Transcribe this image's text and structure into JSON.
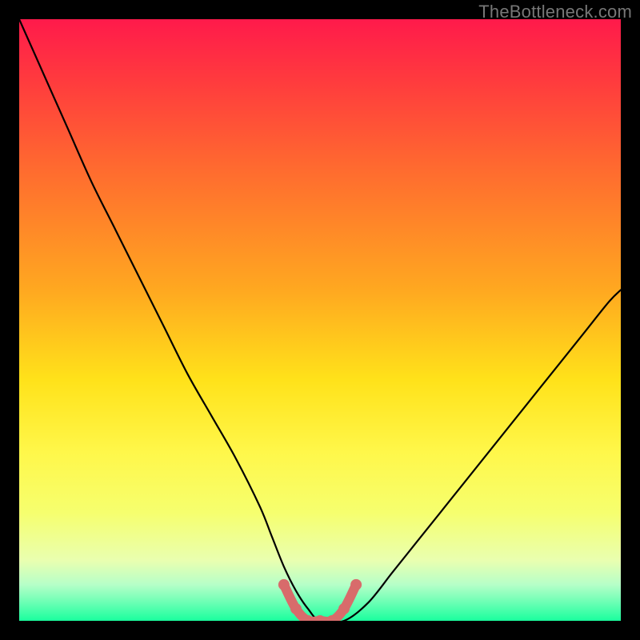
{
  "watermark": "TheBottleneck.com",
  "chart_data": {
    "type": "line",
    "title": "",
    "xlabel": "",
    "ylabel": "",
    "xlim": [
      0,
      100
    ],
    "ylim": [
      0,
      100
    ],
    "background_gradient": {
      "direction": "top-to-bottom",
      "stops": [
        {
          "pct": 0,
          "color": "#ff1a4b"
        },
        {
          "pct": 10,
          "color": "#ff3a3e"
        },
        {
          "pct": 25,
          "color": "#ff6b2f"
        },
        {
          "pct": 45,
          "color": "#ffa820"
        },
        {
          "pct": 60,
          "color": "#ffe21a"
        },
        {
          "pct": 72,
          "color": "#fff74a"
        },
        {
          "pct": 82,
          "color": "#f6ff6e"
        },
        {
          "pct": 90,
          "color": "#e9ffb0"
        },
        {
          "pct": 94,
          "color": "#b6ffc8"
        },
        {
          "pct": 97,
          "color": "#6affb4"
        },
        {
          "pct": 100,
          "color": "#1aff9e"
        }
      ]
    },
    "series": [
      {
        "name": "bottleneck-curve",
        "color": "#000000",
        "x": [
          0,
          4,
          8,
          12,
          16,
          20,
          24,
          28,
          32,
          36,
          40,
          42,
          44,
          46,
          48,
          50,
          54,
          58,
          62,
          66,
          70,
          74,
          78,
          82,
          86,
          90,
          94,
          98,
          100
        ],
        "values": [
          100,
          91,
          82,
          73,
          65,
          57,
          49,
          41,
          34,
          27,
          19,
          14,
          9,
          5,
          2,
          0,
          0,
          3,
          8,
          13,
          18,
          23,
          28,
          33,
          38,
          43,
          48,
          53,
          55
        ]
      },
      {
        "name": "flat-highlight",
        "color": "#d86b6b",
        "x": [
          44,
          46,
          48,
          50,
          52,
          54,
          56
        ],
        "values": [
          6,
          2,
          0,
          0,
          0,
          2,
          6
        ]
      }
    ],
    "annotations": []
  }
}
